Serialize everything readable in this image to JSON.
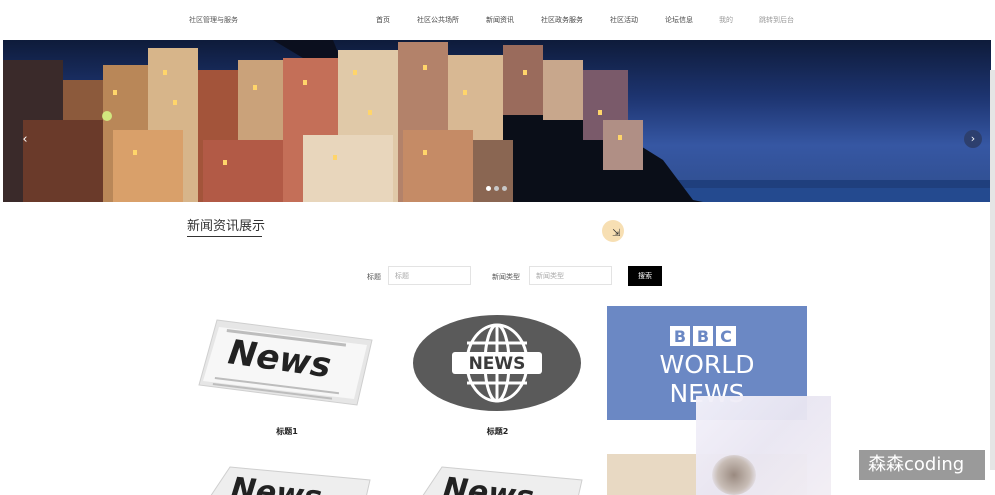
{
  "header": {
    "site_title": "社区管理与服务",
    "nav": [
      "首页",
      "社区公共场所",
      "新闻资讯",
      "社区政务服务",
      "社区活动",
      "论坛信息",
      "我的",
      "跳转到后台"
    ]
  },
  "banner": {
    "prev_icon": "chevron-left-icon",
    "next_icon": "chevron-right-icon",
    "slide_count": 3,
    "active_slide": 1
  },
  "section": {
    "title": "新闻资讯展示"
  },
  "search": {
    "title_label": "标题",
    "title_placeholder": "标题",
    "type_label": "新闻类型",
    "type_placeholder": "新闻类型",
    "button_label": "搜索"
  },
  "news": [
    {
      "title": "标题1",
      "image": "newspaper-news"
    },
    {
      "title": "标题2",
      "image": "news-globe-badge"
    },
    {
      "title": "",
      "image": "bbc-world-news",
      "image_text": [
        "BBC",
        "WORLD",
        "NEWS"
      ]
    },
    {
      "title": "",
      "image": "newspaper-news"
    },
    {
      "title": "",
      "image": "newspaper-news"
    }
  ],
  "watermark": "森森coding",
  "colors": {
    "button_bg": "#000000",
    "bbc_blue": "#6b88c4",
    "banner_sea": "#3657a3"
  }
}
